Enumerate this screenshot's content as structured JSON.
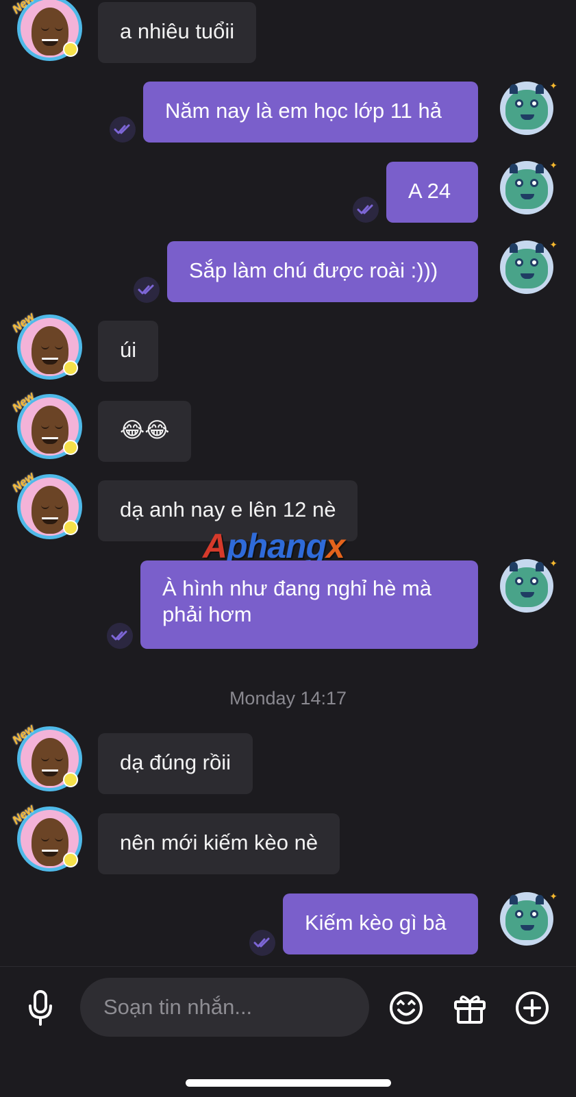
{
  "messages": [
    {
      "dir": "in",
      "text": "a nhiêu tuổii"
    },
    {
      "dir": "out",
      "text": "Năm nay là em học lớp 11 hả"
    },
    {
      "dir": "out",
      "text": "A 24"
    },
    {
      "dir": "out",
      "text": "Sắp làm chú được roài :)))"
    },
    {
      "dir": "in",
      "text": "úi"
    },
    {
      "dir": "in",
      "text": "😂😂"
    },
    {
      "dir": "in",
      "text": "dạ anh nay e lên 12 nè"
    },
    {
      "dir": "out",
      "text": "À hình như đang nghỉ hè mà phải hơm"
    },
    {
      "dir": "in",
      "text": "dạ đúng rồii"
    },
    {
      "dir": "in",
      "text": "nên mới kiếm kèo nè"
    },
    {
      "dir": "out",
      "text": "Kiếm kèo gì bà"
    }
  ],
  "avatar_badge": "New",
  "timestamp": "Monday 14:17",
  "watermark": {
    "a": "A",
    "main": "phang",
    "x": "x"
  },
  "composer": {
    "placeholder": "Soạn tin nhắn...",
    "icons": [
      "microphone-icon",
      "emoji-icon",
      "gift-icon",
      "plus-icon"
    ]
  },
  "colors": {
    "background": "#1c1b1f",
    "incoming_bubble": "#2c2b30",
    "outgoing_bubble": "#7a5fcb",
    "read_tick": "#7d66d6"
  }
}
